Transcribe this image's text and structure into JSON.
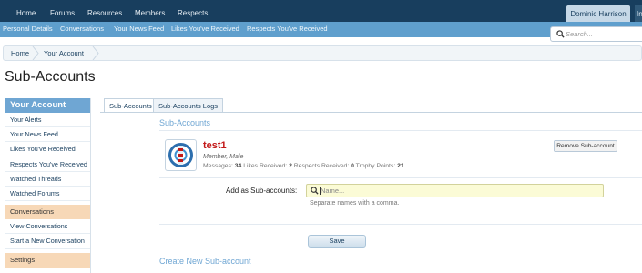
{
  "topnav": {
    "items": [
      "Home",
      "Forums",
      "Resources",
      "Members",
      "Respects"
    ],
    "user": "Dominic Harrison",
    "trunc": "In"
  },
  "subnav": {
    "items": [
      "Personal Details",
      "Conversations",
      "Your News Feed",
      "Likes You've Received",
      "Respects You've Received"
    ]
  },
  "search": {
    "placeholder": "Search..."
  },
  "breadcrumb": [
    "Home",
    "Your Account"
  ],
  "page_title": "Sub-Accounts",
  "sidebar": {
    "header": "Your Account",
    "items": [
      "Your Alerts",
      "Your News Feed",
      "Likes You've Received",
      "Respects You've Received",
      "Watched Threads",
      "Watched Forums"
    ],
    "conversations_header": "Conversations",
    "conversation_items": [
      "View Conversations",
      "Start a New Conversation"
    ],
    "settings_header": "Settings"
  },
  "tabs": [
    "Sub-Accounts",
    "Sub-Accounts Logs"
  ],
  "sub_accounts": {
    "title": "Sub-Accounts",
    "account": {
      "name": "test1",
      "title": "Member, Male",
      "messages_label": "Messages:",
      "messages": "34",
      "likes_label": "Likes Received:",
      "likes": "2",
      "respects_label": "Respects Received:",
      "respects": "0",
      "trophy_label": "Trophy Points:",
      "trophy": "21"
    },
    "remove_label": "Remove Sub-account",
    "add_label": "Add as Sub-accounts:",
    "add_placeholder": "Name...",
    "help": "Separate names with a comma.",
    "save_label": "Save"
  },
  "create_title": "Create New Sub-account"
}
